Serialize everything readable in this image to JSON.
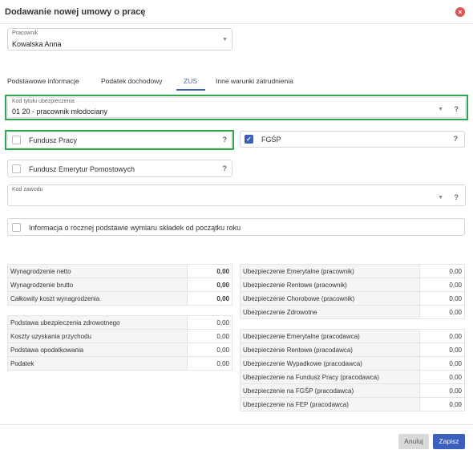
{
  "dialog": {
    "title": "Dodawanie nowej umowy o pracę",
    "close_icon": "×"
  },
  "employee": {
    "label": "Pracownik",
    "value": "Kowalska Anna"
  },
  "tabs": [
    {
      "label": "Podstawowe informacje"
    },
    {
      "label": "Podatek dochodowy"
    },
    {
      "label": "ZUS"
    },
    {
      "label": "Inne warunki zatrudnienia"
    }
  ],
  "active_tab": "ZUS",
  "insurance_code": {
    "label": "Kod tytułu ubezpieczenia",
    "value": "01 20 - pracownik młodociany"
  },
  "help": "?",
  "caret": "▼",
  "fundusz_pracy": {
    "label": "Fundusz Pracy",
    "checked": false
  },
  "fgsp": {
    "label": "FGŚP",
    "checked": true,
    "check_glyph": "✓"
  },
  "fep": {
    "label": "Fundusz Emerytur Pomostowych",
    "checked": false
  },
  "job_code": {
    "label": "Kod zawodu",
    "value": ""
  },
  "annual_info": {
    "label": "Informacja o rocznej podstawie wymiaru składek od początku roku",
    "checked": false
  },
  "left_table": {
    "group1": [
      {
        "label": "Wynagrodzenie netto",
        "value": "0,00"
      },
      {
        "label": "Wynagrodzenie brutto",
        "value": "0,00"
      },
      {
        "label": "Całkowity koszt wynagrodzenia",
        "value": "0,00"
      }
    ],
    "group2": [
      {
        "label": "Podstawa ubezpieczenia zdrowotnego",
        "value": "0,00"
      },
      {
        "label": "Koszty uzyskania przychodu",
        "value": "0,00"
      },
      {
        "label": "Podstawa opodatkowania",
        "value": "0,00"
      },
      {
        "label": "Podatek",
        "value": "0,00"
      }
    ]
  },
  "right_table": {
    "group1": [
      {
        "label": "Ubezpieczenie Emerytalne (pracownik)",
        "value": "0,00"
      },
      {
        "label": "Ubezpieczenie Rentowe (pracownik)",
        "value": "0,00"
      },
      {
        "label": "Ubezpieczenie Chorobowe (pracownik)",
        "value": "0,00"
      },
      {
        "label": "Ubezpieczenie Zdrowotne",
        "value": "0,00"
      }
    ],
    "group2": [
      {
        "label": "Ubezpieczenie Emerytalne (pracodawca)",
        "value": "0,00"
      },
      {
        "label": "Ubezpieczenie Rentowe (pracodawca)",
        "value": "0,00"
      },
      {
        "label": "Ubezpieczenie Wypadkowe (pracodawca)",
        "value": "0,00"
      },
      {
        "label": "Ubezpieczenie na Fundusz Pracy (pracodawca)",
        "value": "0,00"
      },
      {
        "label": "Ubezpieczenie na FGŚP (pracodawca)",
        "value": "0,00"
      },
      {
        "label": "Ubezpieczenie na FEP (pracodawca)",
        "value": "0,00"
      }
    ]
  },
  "footer": {
    "cancel_label": "Anuluj",
    "save_label": "Zapisz"
  },
  "colors": {
    "accent": "#3a5fbd",
    "highlight": "#2ea84a",
    "close": "#e0534d"
  }
}
